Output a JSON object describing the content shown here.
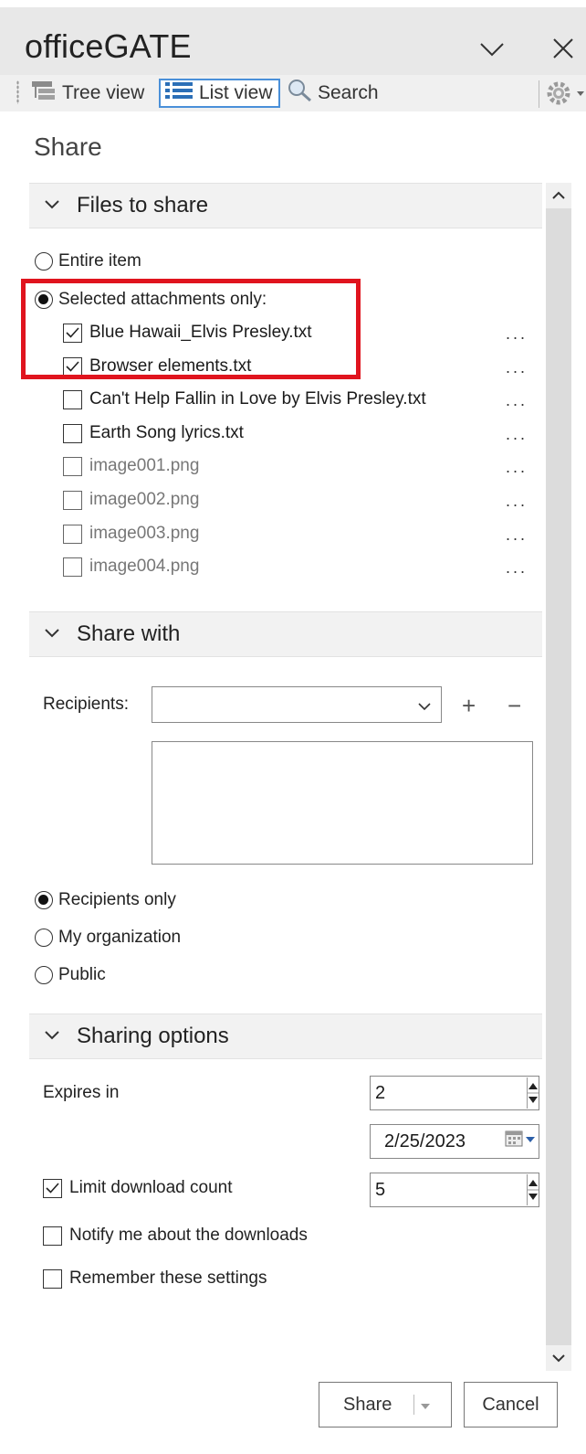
{
  "app": {
    "title": "officeGATE"
  },
  "toolbar": {
    "tree_view": "Tree view",
    "list_view": "List view",
    "search": "Search"
  },
  "panel": {
    "heading": "Share"
  },
  "files_to_share": {
    "header": "Files to share",
    "entire_item": "Entire item",
    "selected_only": "Selected attachments only:",
    "selected_mode": "selected_only",
    "files": [
      {
        "name": "Blue Hawaii_Elvis Presley.txt",
        "checked": true,
        "dimmed": false
      },
      {
        "name": "Browser elements.txt",
        "checked": true,
        "dimmed": false
      },
      {
        "name": "Can't Help Fallin in Love by Elvis Presley.txt",
        "checked": false,
        "dimmed": false
      },
      {
        "name": "Earth Song lyrics.txt",
        "checked": false,
        "dimmed": false
      },
      {
        "name": "image001.png",
        "checked": false,
        "dimmed": true
      },
      {
        "name": "image002.png",
        "checked": false,
        "dimmed": true
      },
      {
        "name": "image003.png",
        "checked": false,
        "dimmed": true
      },
      {
        "name": "image004.png",
        "checked": false,
        "dimmed": true
      }
    ],
    "more_label": "..."
  },
  "share_with": {
    "header": "Share with",
    "recipients_label": "Recipients:",
    "recipients_value": "",
    "add_symbol": "+",
    "remove_symbol": "−",
    "scope": {
      "recipients_only": "Recipients only",
      "my_organization": "My organization",
      "public": "Public",
      "selected": "recipients_only"
    }
  },
  "sharing_options": {
    "header": "Sharing options",
    "expires_label": "Expires in",
    "expires_value": "2",
    "expires_date": "2/25/2023",
    "limit_download_label": "Limit download count",
    "limit_download_checked": true,
    "download_count": "5",
    "notify_label": "Notify me about the downloads",
    "notify_checked": false,
    "remember_label": "Remember these settings",
    "remember_checked": false
  },
  "footer": {
    "share_button": "Share",
    "cancel_button": "Cancel"
  },
  "colors": {
    "highlight_box": "#e0141e",
    "list_view_border": "#4a90d9",
    "titlebar_bg": "#e8e8e8"
  }
}
